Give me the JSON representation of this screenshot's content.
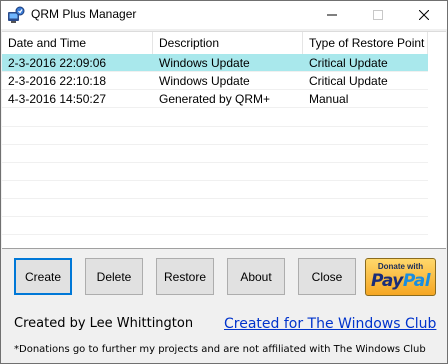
{
  "window": {
    "title": "QRM Plus Manager"
  },
  "listview": {
    "columns": [
      "Date and Time",
      "Description",
      "Type of Restore Point"
    ],
    "rows": [
      {
        "date": "2-3-2016 22:09:06",
        "description": "Windows Update",
        "type": "Critical Update",
        "selected": true
      },
      {
        "date": "2-3-2016 22:10:18",
        "description": "Windows Update",
        "type": "Critical Update",
        "selected": false
      },
      {
        "date": "4-3-2016 14:50:27",
        "description": "Generated by QRM+",
        "type": "Manual",
        "selected": false
      }
    ]
  },
  "buttons": {
    "create": "Create",
    "delete": "Delete",
    "restore": "Restore",
    "about": "About",
    "close": "Close"
  },
  "donate": {
    "caption": "Donate with",
    "brand_part1": "Pay",
    "brand_part2": "Pal"
  },
  "footer": {
    "credit": "Created by Lee Whittington",
    "link": "Created for The Windows Club",
    "disclaimer": "*Donations go to further my projects and are not affiliated with The Windows Club"
  },
  "colors": {
    "selection": "#a9e8ec",
    "default_button_border": "#0078d7",
    "link": "#0033cc"
  }
}
